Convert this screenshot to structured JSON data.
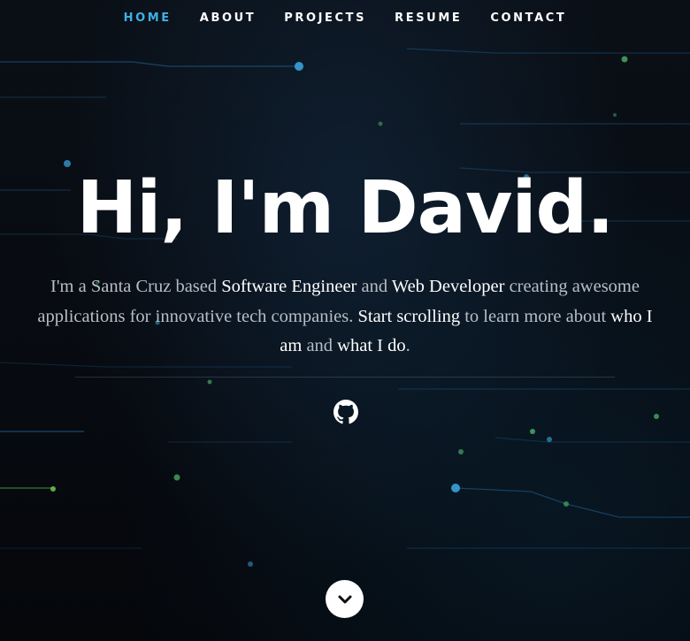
{
  "nav": {
    "items": [
      {
        "label": "HOME",
        "active": true
      },
      {
        "label": "ABOUT",
        "active": false
      },
      {
        "label": "PROJECTS",
        "active": false
      },
      {
        "label": "RESUME",
        "active": false
      },
      {
        "label": "CONTACT",
        "active": false
      }
    ]
  },
  "hero": {
    "headline": "Hi, I'm David.",
    "intro": {
      "p1": "I'm a Santa Cruz based ",
      "h1": "Software Engineer",
      "p2": " and ",
      "h2": "Web Developer",
      "p3": " creating awesome applications for innovative tech companies. ",
      "h3": "Start scrolling",
      "p4": " to learn more about ",
      "h4": "who I am",
      "p5": " and ",
      "h5": "what I do",
      "p6": "."
    }
  },
  "social": {
    "icon": "github-icon"
  },
  "scroll": {
    "icon": "chevron-down-icon"
  },
  "colors": {
    "accent": "#3fb0e6",
    "background": "#07090d",
    "text": "#ffffff",
    "muted_text": "#b8bec6"
  }
}
